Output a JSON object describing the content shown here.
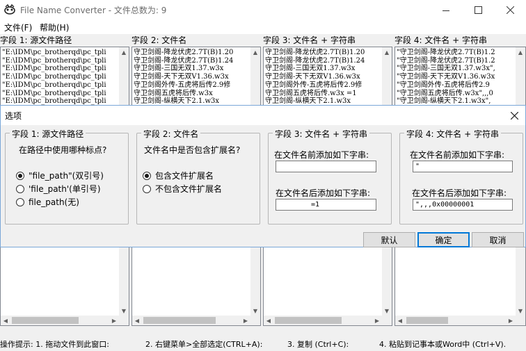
{
  "window": {
    "title": "File Name Converter - 文件总数为: 9"
  },
  "menu": [
    "文件(F)",
    "帮助(H)"
  ],
  "columns": [
    {
      "header": "字段 1: 源文件路径",
      "lines": [
        "\"E:\\IDM\\pc_brotherqd\\pc_tpli",
        "\"E:\\IDM\\pc_brotherqd\\pc_tpli",
        "\"E:\\IDM\\pc_brotherqd\\pc_tpli",
        "\"E:\\IDM\\pc_brotherqd\\pc_tpli",
        "\"E:\\IDM\\pc_brotherqd\\pc_tpli",
        "\"E:\\IDM\\pc_brotherqd\\pc_tpli",
        "\"E:\\IDM\\pc_brotherqd\\pc_tpli"
      ]
    },
    {
      "header": "字段 2: 文件名",
      "lines": [
        "守卫剑阁-降龙伏虎2.7T(B)1.20",
        "守卫剑阁-降龙伏虎2.7T(B)1.24",
        "守卫剑阁-三国无双1.37.w3x",
        "守卫剑阁-天下无双V1.36.w3x",
        "守卫剑阁外传-五虎将后传2.9修",
        "守卫剑阁五虎将后传.w3x",
        "守卫剑阁-纵横天下2.1.w3x"
      ]
    },
    {
      "header": "字段 3: 文件名  + 字符串",
      "lines": [
        "守卫剑阁-降龙伏虎2.7T(B)1.20",
        "守卫剑阁-降龙伏虎2.7T(B)1.24",
        "守卫剑阁-三国无双1.37.w3x",
        "守卫剑阁-天下无双V1.36.w3x",
        "守卫剑阁外传-五虎将后传2.9修",
        "守卫剑阁五虎将后传.w3x  =1",
        "守卫剑阁-纵横天下2.1.w3x"
      ]
    },
    {
      "header": "字段 4: 文件名 + 字符串",
      "lines": [
        "\"守卫剑阁-降龙伏虎2.7T(B)1.2",
        "\"守卫剑阁-降龙伏虎2.7T(B)1.2",
        "\"守卫剑阁-三国无双1.37.w3x\",",
        "\"守卫剑阁-天下无双V1.36.w3x",
        "\"守卫剑阁外传-五虎将后传2.9",
        "\"守卫剑阁五虎将后传.w3x\",,,0",
        "\"守卫剑阁-纵横天下2.1.w3x\","
      ]
    }
  ],
  "status": {
    "hint": "操作提示: 1. 拖动文件到此窗口:",
    "step2": "2. 右键菜单>全部选定(CTRL+A):",
    "step3": "3. 复制 (Ctrl+C):",
    "step4": "4. 粘贴到记事本或Word中 (Ctrl+V)."
  },
  "dialog": {
    "title": "选项",
    "group1": {
      "title": "字段 1: 源文件路径",
      "question": "在路径中使用哪种标点?",
      "options": [
        "\"file_path\"(双引号)",
        "'file_path'(单引号)",
        "file_path(无)"
      ],
      "selected": 0
    },
    "group2": {
      "title": "字段 2: 文件名",
      "question": "文件名中是否包含扩展名?",
      "options": [
        "包含文件扩展名",
        "不包含文件扩展名"
      ],
      "selected": 0
    },
    "group3": {
      "title": "字段 3: 文件名 + 字符串",
      "prefix_label": "在文件名前添加如下字串:",
      "prefix_value": "",
      "suffix_label": "在文件名后添加如下字串:",
      "suffix_value": "=1"
    },
    "group4": {
      "title": "字段 4: 文件名 + 字符串",
      "prefix_label": "在文件名前添加如下字串:",
      "prefix_value": "\"",
      "suffix_label": "在文件名后添加如下字串:",
      "suffix_value": "\",,,0x00000001"
    },
    "buttons": {
      "default": "默认",
      "ok": "确定",
      "cancel": "取消"
    }
  }
}
